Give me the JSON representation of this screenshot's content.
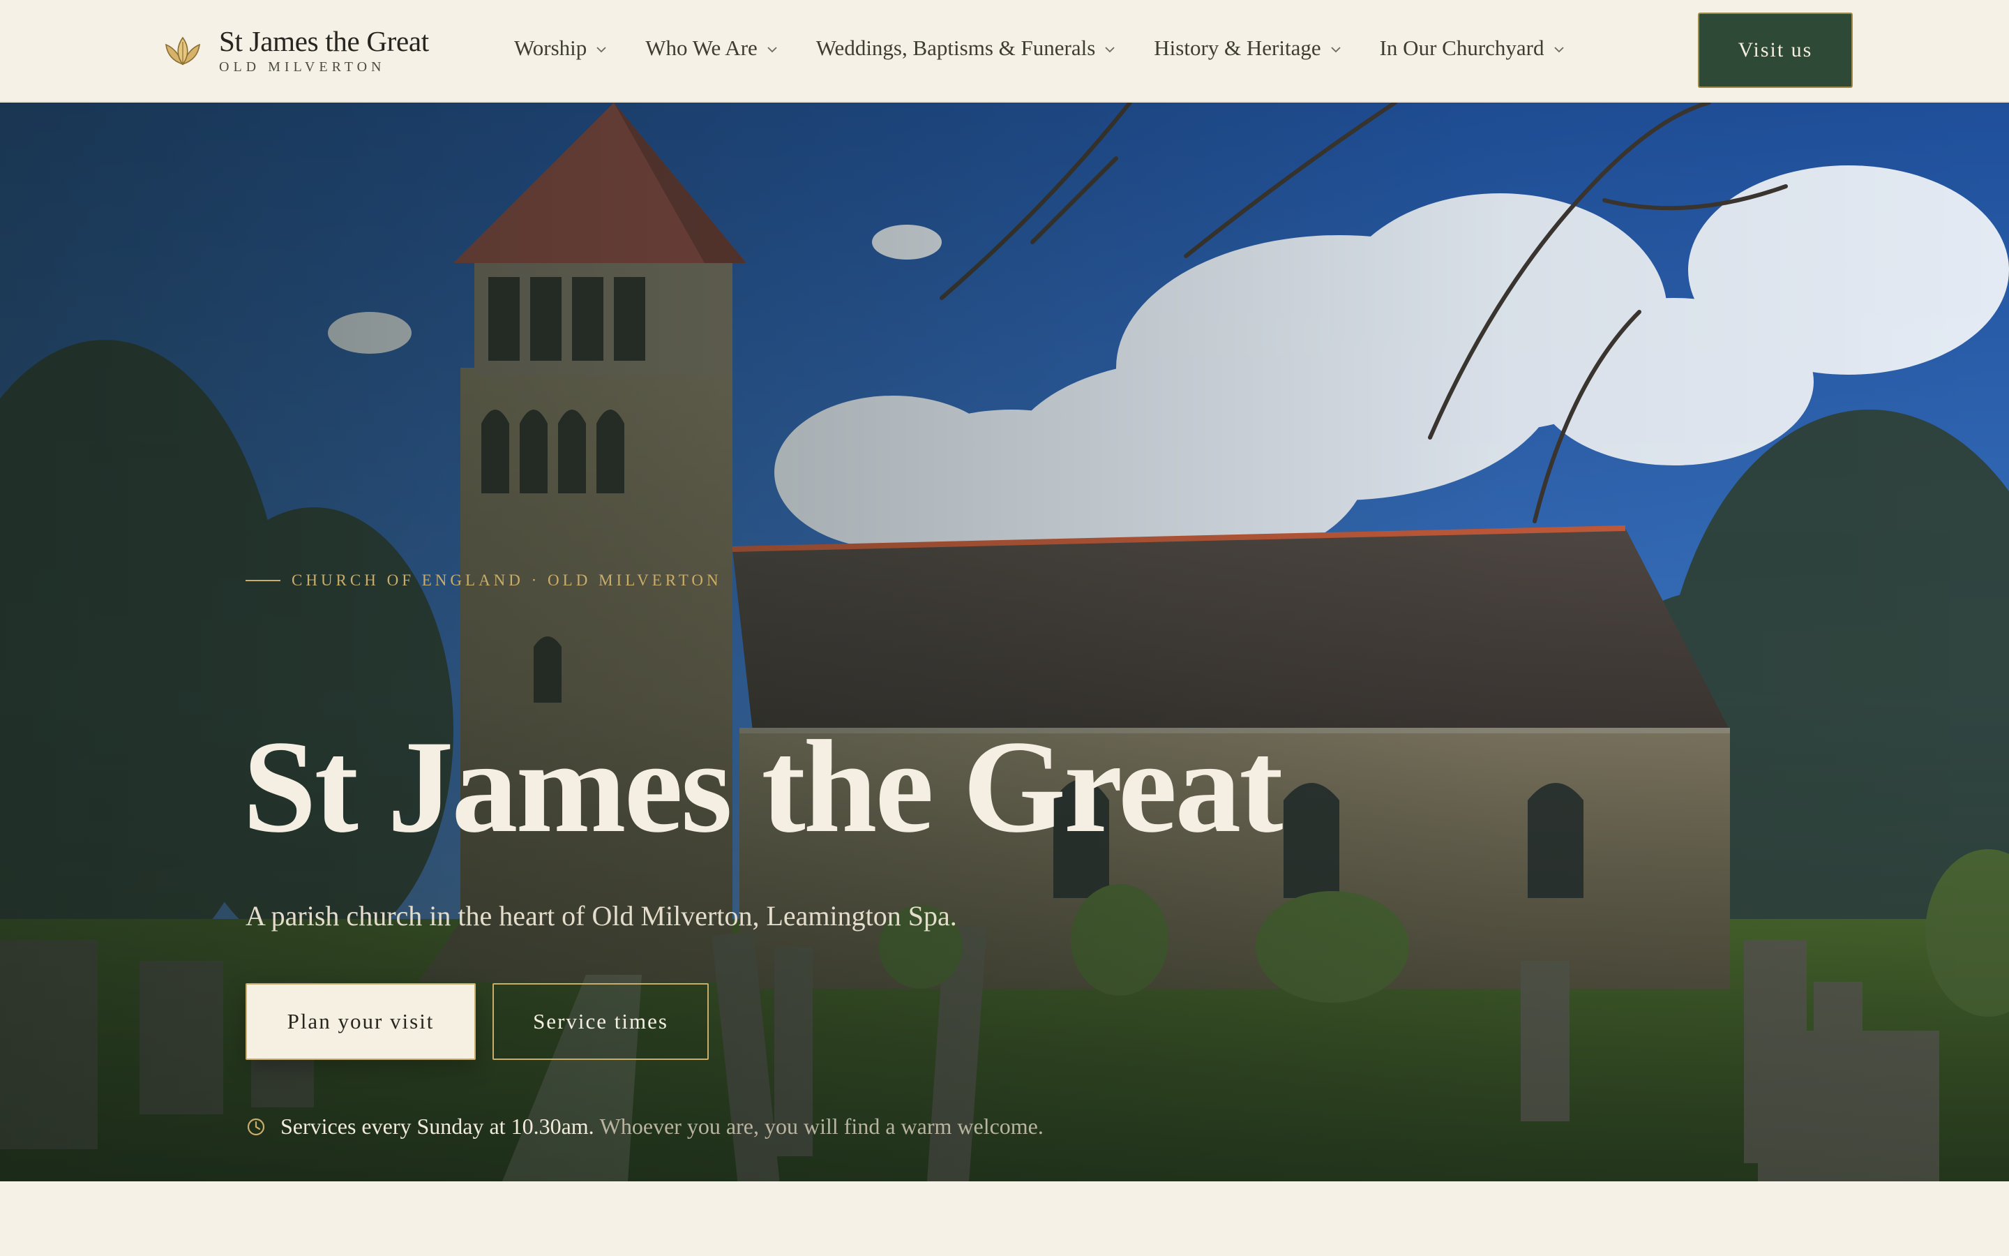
{
  "site": {
    "name": "St James the Great",
    "subtitle": "OLD MILVERTON"
  },
  "nav": {
    "items": [
      {
        "label": "Worship"
      },
      {
        "label": "Who We Are"
      },
      {
        "label": "Weddings, Baptisms & Funerals"
      },
      {
        "label": "History & Heritage"
      },
      {
        "label": "In Our Churchyard"
      }
    ],
    "cta_label": "Visit us"
  },
  "hero": {
    "eyebrow": "CHURCH OF ENGLAND · OLD MILVERTON",
    "title": "St James the Great",
    "subtitle": "A parish church in the heart of Old Milverton, Leamington Spa.",
    "primary_button": "Plan your visit",
    "secondary_button": "Service times",
    "notice_strong": "Services every Sunday at 10.30am.",
    "notice_soft": "Whoever you are, you will find a warm welcome."
  },
  "colors": {
    "background": "#f5f1e6",
    "brand_green": "#2e4a36",
    "gold_accent": "#c9ad6a",
    "text_dark": "#262520"
  },
  "icons": {
    "logo": "lotus-leaf-logo-icon",
    "dropdown": "chevron-down-icon",
    "clock": "clock-icon"
  }
}
